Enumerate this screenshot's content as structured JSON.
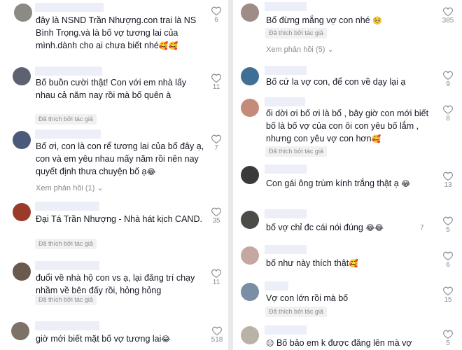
{
  "badge_text": "Đã thích bởi tác giả",
  "left": [
    {
      "id": "c1",
      "text": "đây là NSND Trần Nhượng.con trai là NS\nBình Trọng.và là bố vợ tương lai của\nmình.dành cho ai chưa biết nhé",
      "emoji": "🥰🥰",
      "likes": "6",
      "avatar_color": "#8b8b83"
    },
    {
      "id": "c2",
      "text": "Bố buồn cười thật! Con với em nhà lấy\nnhau cả năm nay rồi mà bố quên à",
      "emoji": "",
      "likes": "11",
      "avatar_color": "#5d6270"
    },
    {
      "id": "c3",
      "text": "Bố ơi, con là con rể tương lai của bố đây ạ,\ncon và em yêu nhau mấy năm rồi nên nay\nquyết định thưa chuyện bố ạ",
      "emoji": "😂",
      "likes": "7",
      "replies": "Xem phản hồi (1)",
      "avatar_color": "#4a5a7a"
    },
    {
      "id": "c4",
      "text": "Đại Tá Trần Nhượng - Nhà hát kịch CAND.",
      "emoji": "",
      "likes": "35",
      "avatar_color": "#9a3b2a"
    },
    {
      "id": "c5",
      "text": "đuổi về nhà hộ con vs ạ, lại đăng trí chạy\nnhầm về bên đấy rồi, hỏng hỏng",
      "emoji": "",
      "likes": "11",
      "avatar_color": "#6a5a4e"
    },
    {
      "id": "c6",
      "text": "giờ mới biết mặt bố vợ tương lai",
      "emoji": "😂",
      "likes": "518",
      "avatar_color": "#7d7268"
    }
  ],
  "right": [
    {
      "id": "r1",
      "text": "Bố đừng mắng vợ con nhé",
      "emoji": "🥺",
      "likes": "385",
      "replies": "Xem phản hồi (5)",
      "avatar_color": "#9e8c86"
    },
    {
      "id": "r2",
      "text": "Bố cứ la vợ con, để con về dạy lại ạ",
      "emoji": "",
      "likes": "9",
      "avatar_color": "#3f6f95"
    },
    {
      "id": "r3",
      "text": "ối dời ơi bố ơi là bố , bây giờ con mới biết\nbố là bố vợ của con ôi con yêu bố lắm ,\nnhưng con yêu vợ con hơn",
      "emoji": "🥰",
      "likes": "8",
      "avatar_color": "#c58b7a"
    },
    {
      "id": "r4",
      "text": "Con gái ông trùm kính trắng thật ạ",
      "emoji": "😂",
      "likes": "13",
      "avatar_color": "#3a3a3a"
    },
    {
      "id": "r5",
      "text": "bố vợ chỉ đc cái nói đúng",
      "emoji": "😂😂",
      "inline_number": "7",
      "likes": "5",
      "avatar_color": "#4b4b48"
    },
    {
      "id": "r6",
      "text": "bố như này thích thật",
      "emoji": "🥰",
      "likes": "6",
      "avatar_color": "#c6a6a0"
    },
    {
      "id": "r7",
      "text": "Vợ con lớn rồi mà bố",
      "emoji": "",
      "likes": "15",
      "avatar_color": "#7a8ea6"
    },
    {
      "id": "r8",
      "text": "Bố bảo em k được đăng lên mà vợ",
      "emoji": "😑",
      "likes": "5",
      "avatar_color": "#b9b2a6"
    }
  ]
}
